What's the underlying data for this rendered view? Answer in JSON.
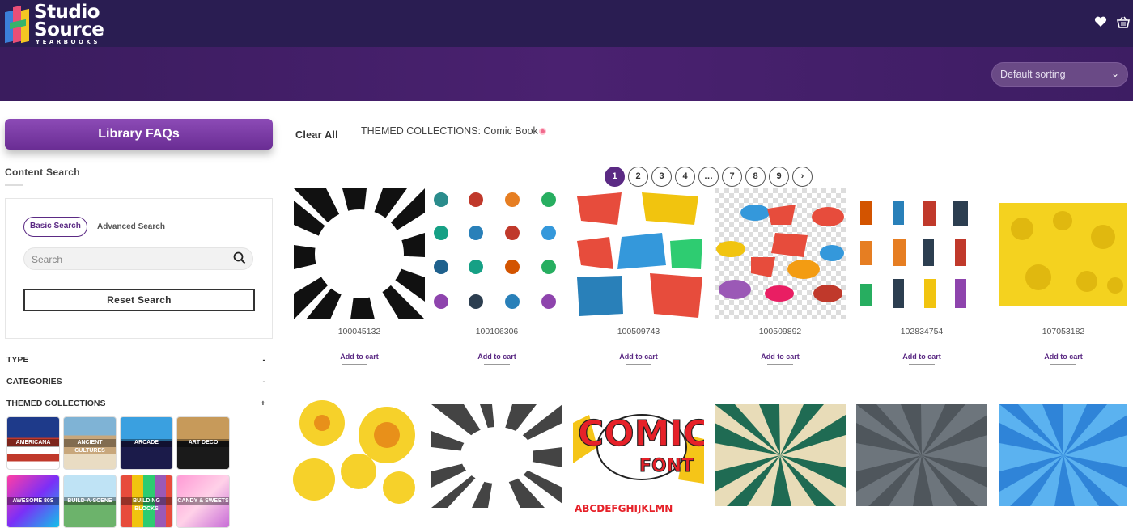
{
  "brand": {
    "line1": "Studio",
    "line2": "Source",
    "line3": "YEARBOOKS"
  },
  "header": {
    "icons": [
      "heart-icon",
      "basket-icon"
    ]
  },
  "sorting": {
    "selected": "Default sorting"
  },
  "sidebar": {
    "faq_button": "Library FAQs",
    "content_search_title": "Content Search",
    "tabs": {
      "basic": "Basic Search",
      "advanced": "Advanced Search"
    },
    "search_placeholder": "Search",
    "reset_button": "Reset Search",
    "facets": [
      {
        "label": "TYPE",
        "symbol": "-"
      },
      {
        "label": "CATEGORIES",
        "symbol": "-"
      },
      {
        "label": "THEMED COLLECTIONS",
        "symbol": "+"
      }
    ],
    "collections": [
      "AMERICANA",
      "ANCIENT CULTURES",
      "ARCADE",
      "ART DECO",
      "AWESOME 80S",
      "BUILD-A-SCENE",
      "BUILDING BLOCKS",
      "CANDY & SWEETS"
    ]
  },
  "filters": {
    "clear_all": "Clear All",
    "active": "THEMED COLLECTIONS: Comic Book"
  },
  "pagination": {
    "pages": [
      "1",
      "2",
      "3",
      "4",
      "…",
      "7",
      "8",
      "9",
      "›"
    ],
    "current": "1"
  },
  "products": [
    {
      "sku": "100045132",
      "action": "Add to cart"
    },
    {
      "sku": "100106306",
      "action": "Add to cart"
    },
    {
      "sku": "100509743",
      "action": "Add to cart"
    },
    {
      "sku": "100509892",
      "action": "Add to cart"
    },
    {
      "sku": "102834754",
      "action": "Add to cart"
    },
    {
      "sku": "107053182",
      "action": "Add to cart"
    }
  ],
  "comic_font_image": {
    "line1": "COMIC",
    "line2": "FONT",
    "alphabet": "ABCDEFGHIJKLMN"
  },
  "colors": {
    "header": "#2a1d52",
    "accent": "#5b2a84",
    "banner": "#4a2170"
  }
}
